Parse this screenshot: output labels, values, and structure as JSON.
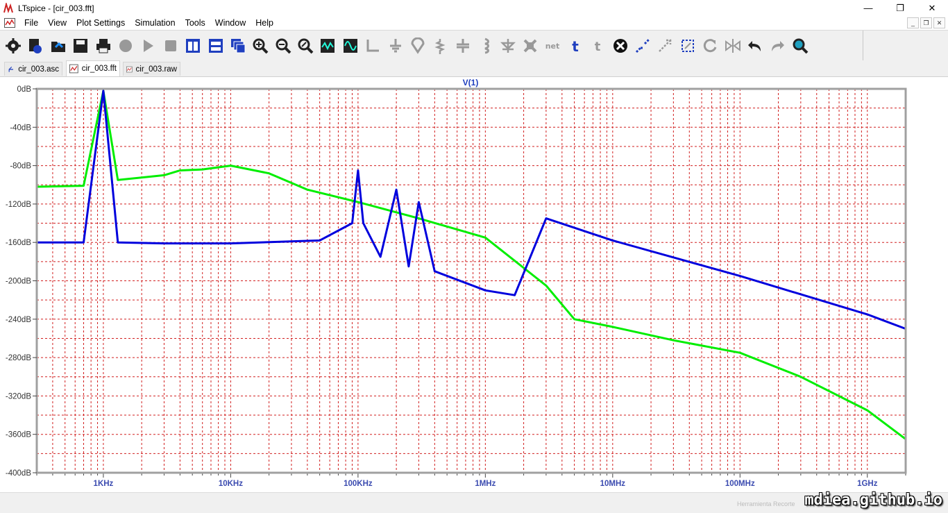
{
  "window": {
    "title": "LTspice - [cir_003.fft]",
    "controls": {
      "minimize": "—",
      "maximize": "❐",
      "close": "✕"
    }
  },
  "menu": {
    "items": [
      "File",
      "View",
      "Plot Settings",
      "Simulation",
      "Tools",
      "Window",
      "Help"
    ],
    "mdi_controls": [
      "_",
      "❐",
      "✕"
    ]
  },
  "toolbar": {
    "icons": [
      "control-panel-icon",
      "open-file-icon",
      "open-folder-icon",
      "save-icon",
      "print-icon",
      "halt-icon",
      "run-icon",
      "stop-icon",
      "tile-vertical-icon",
      "tile-horizontal-icon",
      "cascade-icon",
      "zoom-in-icon",
      "zoom-out-icon",
      "zoom-fit-icon",
      "autorange-icon",
      "waveform-icon",
      "wire-icon",
      "ground-icon",
      "label-icon",
      "resistor-icon",
      "capacitor-icon",
      "inductor-icon",
      "diode-icon",
      "component-icon",
      "net-icon",
      "text-icon",
      "spice-directive-icon",
      "delete-icon",
      "duplicate-icon",
      "move-icon",
      "drag-icon",
      "rotate-icon",
      "mirror-icon",
      "undo-icon",
      "redo-icon",
      "find-icon"
    ]
  },
  "tabs": [
    {
      "label": "cir_003.asc",
      "icon": "schematic-icon",
      "active": false
    },
    {
      "label": "cir_003.fft",
      "icon": "waveform-icon",
      "active": true
    },
    {
      "label": "cir_003.raw",
      "icon": "waveform-icon",
      "active": false
    }
  ],
  "plot": {
    "trace_name": "V(1)",
    "y_ticks": [
      "0dB",
      "-40dB",
      "-80dB",
      "-120dB",
      "-160dB",
      "-200dB",
      "-240dB",
      "-280dB",
      "-320dB",
      "-360dB",
      "-400dB"
    ],
    "x_ticks": [
      "1KHz",
      "10KHz",
      "100KHz",
      "1MHz",
      "10MHz",
      "100MHz",
      "1GHz"
    ]
  },
  "chart_data": {
    "type": "line",
    "title": "V(1)",
    "xlabel": "",
    "ylabel": "",
    "x_scale": "log",
    "xlim": [
      300,
      2000000000
    ],
    "ylim": [
      -400,
      0
    ],
    "grid": true,
    "series": [
      {
        "color": "#00ee00",
        "x": [
          300,
          700,
          1000,
          1300,
          3000,
          4000,
          6000,
          10000,
          20000,
          40000,
          100000,
          300000,
          1000000,
          3000000,
          5000000,
          10000000,
          30000000,
          100000000,
          300000000,
          1000000000,
          2000000000
        ],
        "y": [
          -102,
          -101,
          -2,
          -95,
          -90,
          -85,
          -84,
          -80,
          -88,
          -105,
          -118,
          -135,
          -155,
          -205,
          -240,
          -248,
          -262,
          -275,
          -300,
          -335,
          -365
        ]
      },
      {
        "color": "#0000dd",
        "x": [
          300,
          700,
          1000,
          1300,
          3000,
          10000,
          50000,
          90000,
          100000,
          110000,
          150000,
          200000,
          250000,
          300000,
          400000,
          1000000,
          1700000,
          3000000,
          10000000,
          100000000,
          1000000000,
          2000000000
        ],
        "y": [
          -160,
          -160,
          -2,
          -160,
          -161,
          -161,
          -158,
          -140,
          -85,
          -140,
          -175,
          -105,
          -185,
          -118,
          -190,
          -210,
          -215,
          -135,
          -158,
          -195,
          -235,
          -250
        ]
      }
    ]
  },
  "status": {
    "watermark": "mdiea.github.io",
    "faint_text": "Herramienta Recorte"
  },
  "colors": {
    "grid": "#d11e1e",
    "plot_border": "#a0a0a0",
    "label_blue": "#1f3fbf",
    "trace_green": "#00ee00",
    "trace_blue": "#0000dd"
  }
}
